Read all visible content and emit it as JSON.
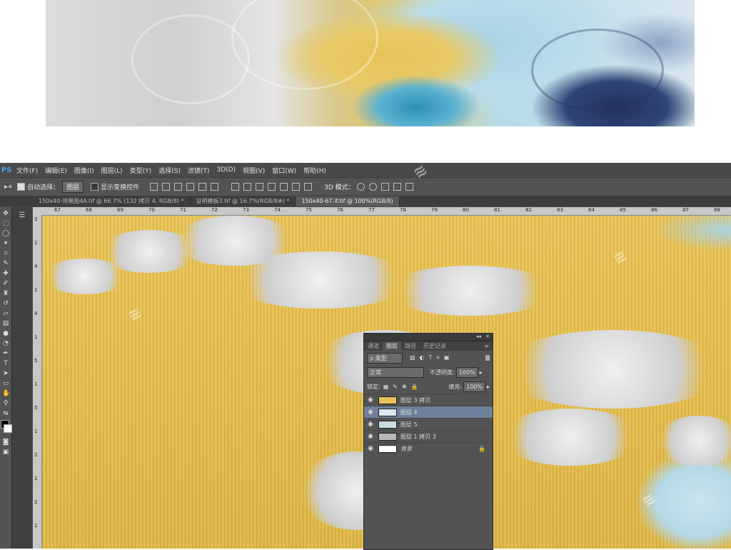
{
  "menubar": {
    "logo": "PS",
    "items": [
      "文件(F)",
      "编辑(E)",
      "图像(I)",
      "图层(L)",
      "类型(Y)",
      "选择(S)",
      "滤镜(T)",
      "3D(D)",
      "视图(V)",
      "窗口(W)",
      "帮助(H)"
    ]
  },
  "options": {
    "auto_select_label": "自动选择：",
    "auto_select_value": "图层",
    "show_transform_label": "显示变换控件",
    "mode_3d_label": "3D 模式："
  },
  "tabs": [
    {
      "label": "150x40-效果图4A.tif @ 66.7% (132 拷贝 4, RGB/8) *",
      "active": false
    },
    {
      "label": "证明模板3.tif @ 16.7%(RGB/8#) *",
      "active": false
    },
    {
      "label": "150x40-67.if.tif @ 100%(RGB/8)",
      "active": true
    }
  ],
  "ruler_h": [
    "67",
    "68",
    "69",
    "70",
    "71",
    "72",
    "73",
    "74",
    "75",
    "76",
    "77",
    "78",
    "79",
    "80",
    "81",
    "82",
    "83",
    "84",
    "85",
    "86",
    "87",
    "88"
  ],
  "ruler_v": [
    "3",
    "1",
    "4",
    "1",
    "4",
    "1",
    "5",
    "1",
    "5",
    "1",
    "2",
    "1",
    "2",
    "1"
  ],
  "layers_panel": {
    "tabs": [
      "通道",
      "图层",
      "路径",
      "历史记录"
    ],
    "active_tab": "图层",
    "filter_label": "ρ 类型",
    "blend_mode": "正常",
    "opacity_label": "不透明度:",
    "opacity_value": "100%",
    "lock_label": "锁定:",
    "fill_label": "填充:",
    "fill_value": "100%",
    "layers": [
      {
        "name": "图层 3 拷贝",
        "selected": false,
        "thumb": "#e8c25a"
      },
      {
        "name": "图层 4",
        "selected": true,
        "thumb": "#d8e8f0"
      },
      {
        "name": "图层 5",
        "selected": false,
        "thumb": "#c9dce6"
      },
      {
        "name": "图层 1 拷贝 3",
        "selected": false,
        "thumb": "#b8b8b8"
      },
      {
        "name": "背景",
        "selected": false,
        "thumb": "#ffffff",
        "locked": true
      }
    ]
  }
}
